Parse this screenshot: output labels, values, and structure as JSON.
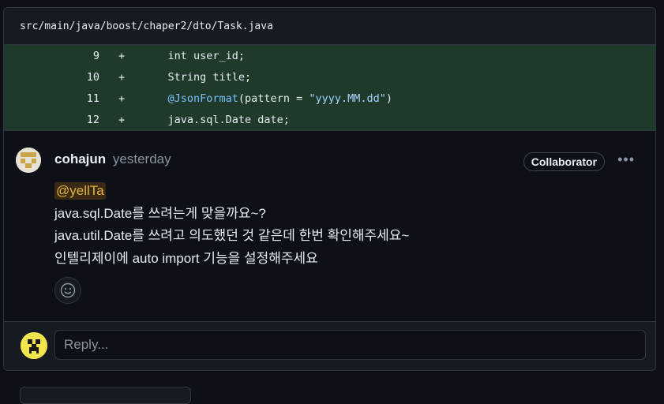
{
  "file": {
    "path": "src/main/java/boost/chaper2/dto/Task.java"
  },
  "diff_lines": [
    {
      "number": "9",
      "sign": "+",
      "code": "    int user_id;"
    },
    {
      "number": "10",
      "sign": "+",
      "code": "    String title;"
    },
    {
      "number": "11",
      "sign": "+",
      "code_annotation": "@JsonFormat",
      "code_mid": "(pattern = ",
      "code_string": "\"yyyy.MM.dd\"",
      "code_end": ")"
    },
    {
      "number": "12",
      "sign": "+",
      "code": "    java.sql.Date date;"
    }
  ],
  "comment": {
    "author": "cohajun",
    "time": "yesterday",
    "role": "Collaborator",
    "more_icon": "kebab-horizontal-icon",
    "mention": "@yellTa",
    "lines": [
      "java.sql.Date를 쓰려는게 맞을까요~?",
      "java.util.Date를 쓰려고 의도했던 것 같은데 한번 확인해주세요~",
      "인텔리제이에 auto import 기능을 설정해주세요"
    ],
    "reaction_icon": "smiley-icon"
  },
  "reply": {
    "placeholder": "Reply..."
  },
  "colors": {
    "background": "#0d1117",
    "diff_added": "#1f3a2a",
    "mention_text": "#e3b341",
    "avatar_user": "#f0e54a"
  }
}
